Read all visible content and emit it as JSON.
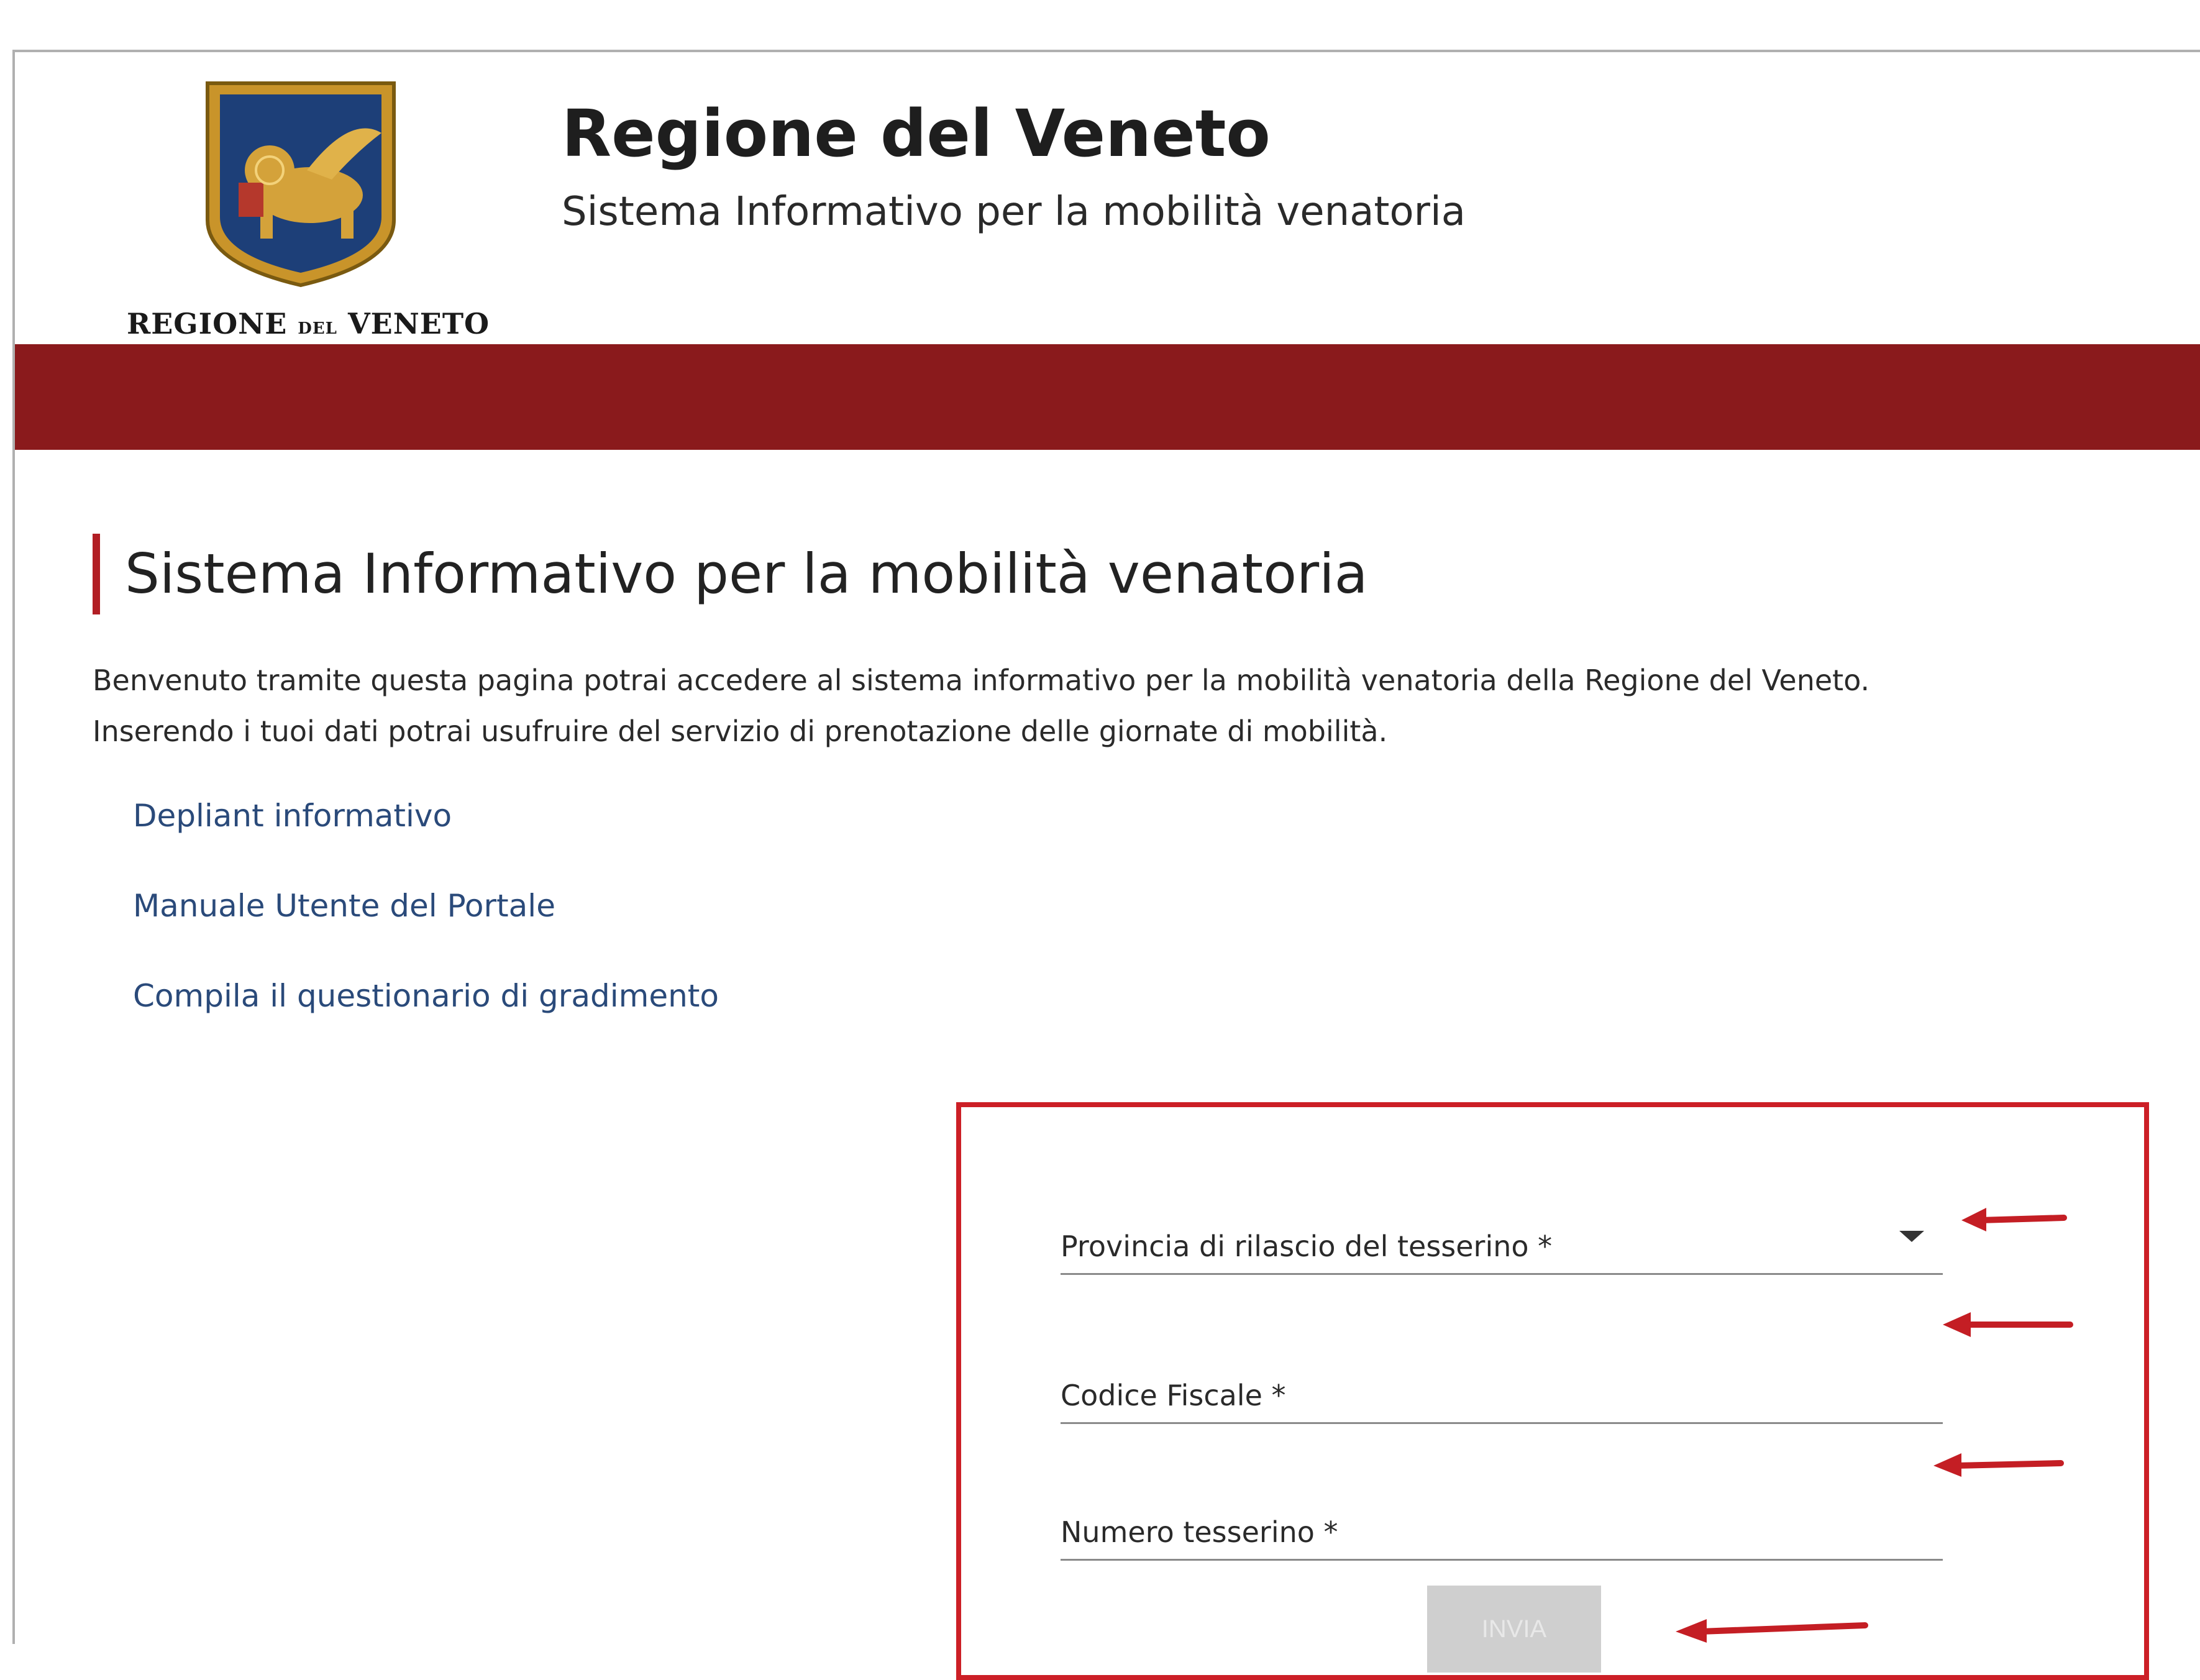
{
  "header": {
    "logo_text_main_1": "REGIONE",
    "logo_text_small": "DEL",
    "logo_text_main_2": "VENETO",
    "title": "Regione del Veneto",
    "subtitle": "Sistema Informativo per la mobilità venatoria"
  },
  "main": {
    "heading": "Sistema Informativo per la mobilità venatoria",
    "intro_line1": "Benvenuto tramite questa pagina potrai accedere al sistema informativo per la mobilità venatoria della Regione del Veneto.",
    "intro_line2": "Inserendo i tuoi dati potrai usufruire del servizio di prenotazione delle giornate di mobilità.",
    "links": [
      {
        "label": "Depliant informativo"
      },
      {
        "label": "Manuale Utente del Portale"
      },
      {
        "label": "Compila il questionario di gradimento"
      }
    ]
  },
  "form": {
    "fields": [
      {
        "label": "Provincia di rilascio del tesserino *"
      },
      {
        "label": "Codice Fiscale *"
      },
      {
        "label": "Numero tesserino *"
      }
    ],
    "submit_label": "INVIA"
  },
  "colors": {
    "band": "#8a1a1c",
    "accent": "#b21e24",
    "highlight_box": "#cc1f26",
    "link": "#2a4a7a",
    "annotation_arrow": "#c41e24"
  },
  "icons": {
    "logo": "lion-of-st-mark-shield-icon",
    "dropdown": "caret-down-icon",
    "annotation": "red-arrow-left-icon"
  }
}
